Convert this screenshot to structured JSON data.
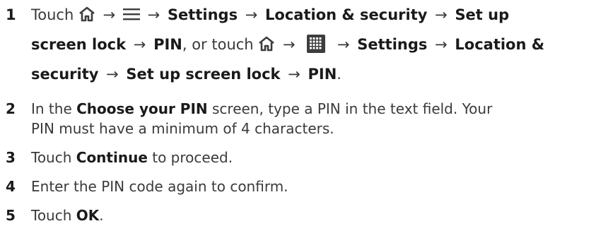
{
  "steps": [
    {
      "number": "1",
      "t_touch": "Touch",
      "icons": [
        "home-icon",
        "menu-icon",
        "home-icon",
        "apps-grid-icon"
      ],
      "arrow": "→",
      "settings": "Settings",
      "location_security": "Location & security",
      "set_up": "Set up",
      "screen_lock": "screen lock",
      "pin": "PIN",
      "or_touch": ", or touch",
      "settings2": "Settings",
      "location_amp": "Location &",
      "security": "security",
      "set_up_screen_lock": "Set up screen lock",
      "pin2": "PIN",
      "period": "."
    },
    {
      "number": "2",
      "pre": "In the ",
      "bold": "Choose your PIN",
      "post": " screen, type a PIN in the text field. Your",
      "line2": "PIN must have a minimum of 4 characters."
    },
    {
      "number": "3",
      "pre": "Touch ",
      "bold": "Continue",
      "post": " to proceed."
    },
    {
      "number": "4",
      "text": "Enter the PIN code again to confirm."
    },
    {
      "number": "5",
      "pre": "Touch ",
      "bold": "OK",
      "post": "."
    }
  ],
  "colors": {
    "text": "#3a3a3a",
    "bold": "#1a1a1a",
    "icon": "#3d3d3d"
  }
}
